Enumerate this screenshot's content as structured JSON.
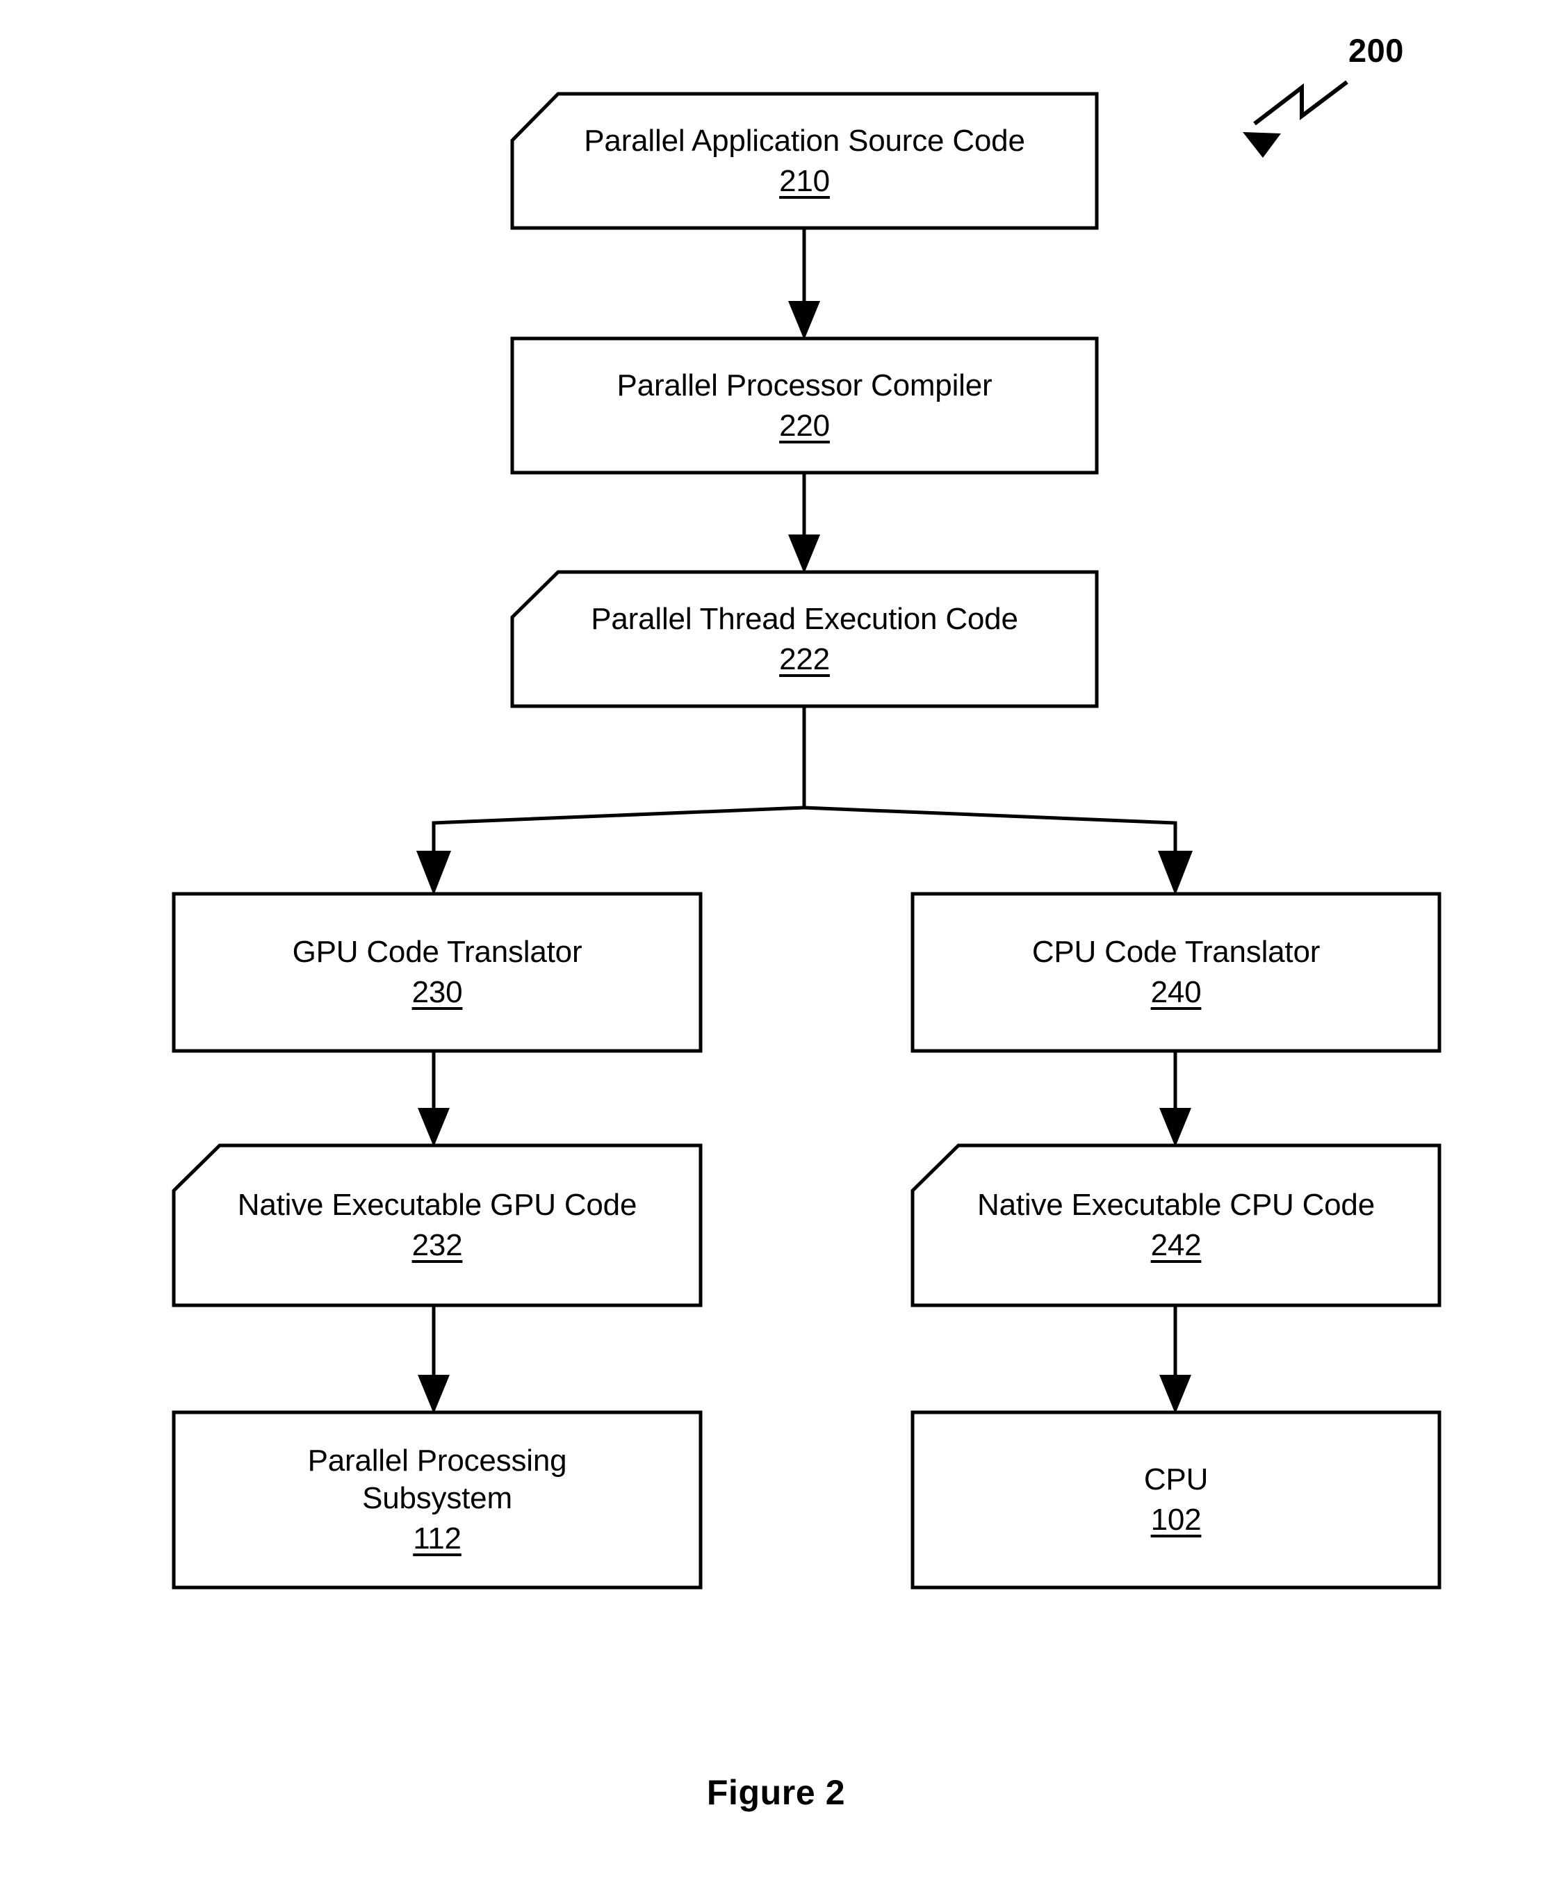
{
  "figure": {
    "caption": "Figure 2",
    "callout_ref": "200"
  },
  "nodes": [
    {
      "id": "parallel-application-source-code",
      "label": "Parallel Application Source Code",
      "ref": "210",
      "shape": "document-clipped-corner"
    },
    {
      "id": "parallel-processor-compiler",
      "label": "Parallel Processor Compiler",
      "ref": "220",
      "shape": "rectangle"
    },
    {
      "id": "parallel-thread-execution-code",
      "label": "Parallel Thread Execution Code",
      "ref": "222",
      "shape": "document-clipped-corner"
    },
    {
      "id": "gpu-code-translator",
      "label": "GPU Code Translator",
      "ref": "230",
      "shape": "rectangle"
    },
    {
      "id": "cpu-code-translator",
      "label": "CPU Code Translator",
      "ref": "240",
      "shape": "rectangle"
    },
    {
      "id": "native-executable-gpu-code",
      "label": "Native Executable GPU Code",
      "ref": "232",
      "shape": "document-clipped-corner"
    },
    {
      "id": "native-executable-cpu-code",
      "label": "Native Executable CPU Code",
      "ref": "242",
      "shape": "document-clipped-corner"
    },
    {
      "id": "parallel-processing-subsystem",
      "label": "Parallel Processing\nSubsystem",
      "ref": "112",
      "shape": "rectangle"
    },
    {
      "id": "cpu",
      "label": "CPU",
      "ref": "102",
      "shape": "rectangle"
    }
  ],
  "edges": [
    {
      "id": "edge-210-to-220",
      "from": "parallel-application-source-code",
      "to": "parallel-processor-compiler",
      "style": "straight-arrow"
    },
    {
      "id": "edge-220-to-222",
      "from": "parallel-processor-compiler",
      "to": "parallel-thread-execution-code",
      "style": "straight-arrow"
    },
    {
      "id": "edge-222-to-230",
      "from": "parallel-thread-execution-code",
      "to": "gpu-code-translator",
      "style": "branch-left-arrow"
    },
    {
      "id": "edge-222-to-240",
      "from": "parallel-thread-execution-code",
      "to": "cpu-code-translator",
      "style": "branch-right-arrow"
    },
    {
      "id": "edge-230-to-232",
      "from": "gpu-code-translator",
      "to": "native-executable-gpu-code",
      "style": "straight-arrow"
    },
    {
      "id": "edge-240-to-242",
      "from": "cpu-code-translator",
      "to": "native-executable-cpu-code",
      "style": "straight-arrow"
    },
    {
      "id": "edge-232-to-112",
      "from": "native-executable-gpu-code",
      "to": "parallel-processing-subsystem",
      "style": "straight-arrow"
    },
    {
      "id": "edge-242-to-102",
      "from": "native-executable-cpu-code",
      "to": "cpu",
      "style": "straight-arrow"
    }
  ],
  "colors": {
    "stroke": "#000000",
    "fill": "#ffffff",
    "text": "#000000"
  }
}
